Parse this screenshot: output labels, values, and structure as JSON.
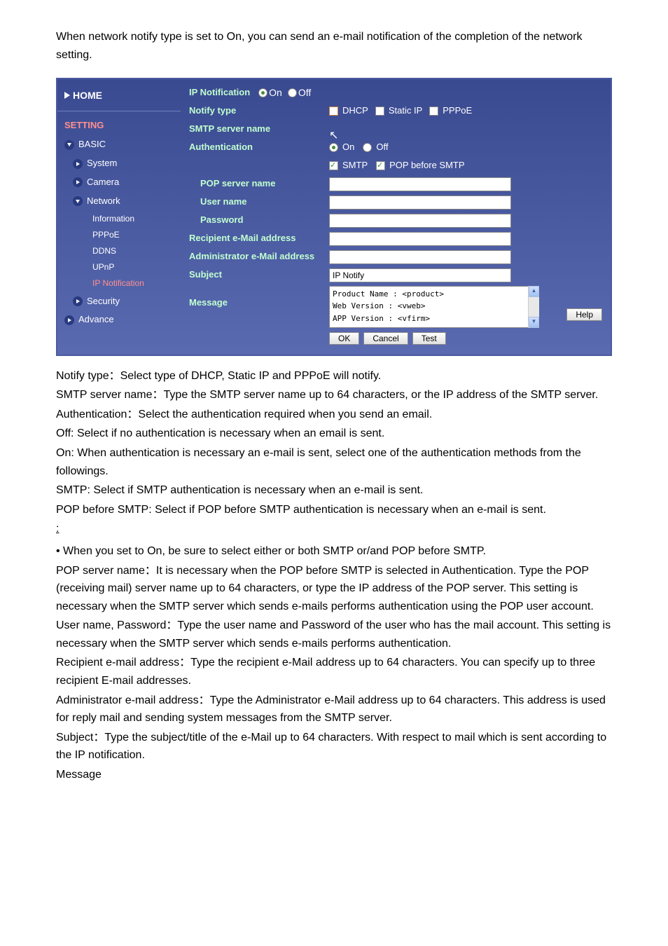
{
  "intro": "When network notify type is set to On, you can send an e-mail notification of the completion of the network setting.",
  "sidebar": {
    "home": "HOME",
    "setting": "SETTING",
    "items": [
      {
        "label": "BASIC",
        "icon": "down"
      },
      {
        "label": "System",
        "icon": "right"
      },
      {
        "label": "Camera",
        "icon": "right"
      },
      {
        "label": "Network",
        "icon": "down"
      }
    ],
    "subs": [
      {
        "label": "Information"
      },
      {
        "label": "PPPoE"
      },
      {
        "label": "DDNS"
      },
      {
        "label": "UPnP"
      },
      {
        "label": "IP Notification",
        "active": true
      }
    ],
    "items2": [
      {
        "label": "Security",
        "icon": "right"
      },
      {
        "label": "Advance",
        "icon": "right"
      }
    ]
  },
  "form": {
    "ip_notification_label": "IP Notification",
    "on": "On",
    "off": "Off",
    "notify_type_label": "Notify type",
    "dhcp": "DHCP",
    "static_ip": "Static IP",
    "pppoe": "PPPoE",
    "smtp_server_label": "SMTP server name",
    "auth_label": "Authentication",
    "smtp": "SMTP",
    "pop_before": "POP before SMTP",
    "pop_server_label": "POP server name",
    "username_label": "User name",
    "password_label": "Password",
    "recipient_label": "Recipient e-Mail address",
    "admin_label": "Administrator e-Mail address",
    "subject_label": "Subject",
    "subject_value": "IP Notify",
    "message_label": "Message",
    "message_value": "Product Name : <product>\nWeb Version : <vweb>\nAPP Version : <vfirm>\nhttp://<ip>:<port>",
    "ok": "OK",
    "cancel": "Cancel",
    "test": "Test",
    "help": "Help"
  },
  "desc": {
    "l1": "Notify type：Select type of DHCP, Static IP and PPPoE will notify.",
    "l2": "SMTP server name：Type the SMTP server name up to 64 characters, or the IP address of the SMTP server.",
    "l3": "Authentication：Select the authentication required when you send an email.",
    "l4": "Off: Select if no authentication is necessary when an email is sent.",
    "l5": "On: When authentication is necessary an e-mail is sent, select one of the authentication methods from the followings.",
    "l6": "SMTP: Select if SMTP authentication is necessary when an e-mail is sent.",
    "l7": "POP before SMTP: Select if POP before SMTP authentication is necessary when an e-mail is sent.",
    "note": "           :",
    "l8": "• When you set to On, be sure to select either or both SMTP or/and POP before SMTP.",
    "l9": "POP server name：It is necessary when the POP before SMTP is selected in Authentication. Type the POP (receiving mail) server name up to 64 characters, or type the IP address of the POP server. This setting is necessary when the SMTP server which sends e-mails performs authentication using the POP user account.",
    "l10": "User name, Password：Type the user name and Password of the user who has the mail account. This setting is necessary when the SMTP server which sends e-mails performs authentication.",
    "l11": "Recipient e-mail address：Type the recipient e-Mail address up to 64 characters. You can specify up to three recipient E-mail addresses.",
    "l12": "Administrator e-mail address：Type the Administrator e-Mail address up to 64 characters. This address is used for reply mail and sending system messages from the SMTP server.",
    "l13": "Subject：Type the subject/title of the e-Mail up to 64 characters. With respect to mail which is sent according to the IP notification.",
    "l14": "Message"
  }
}
